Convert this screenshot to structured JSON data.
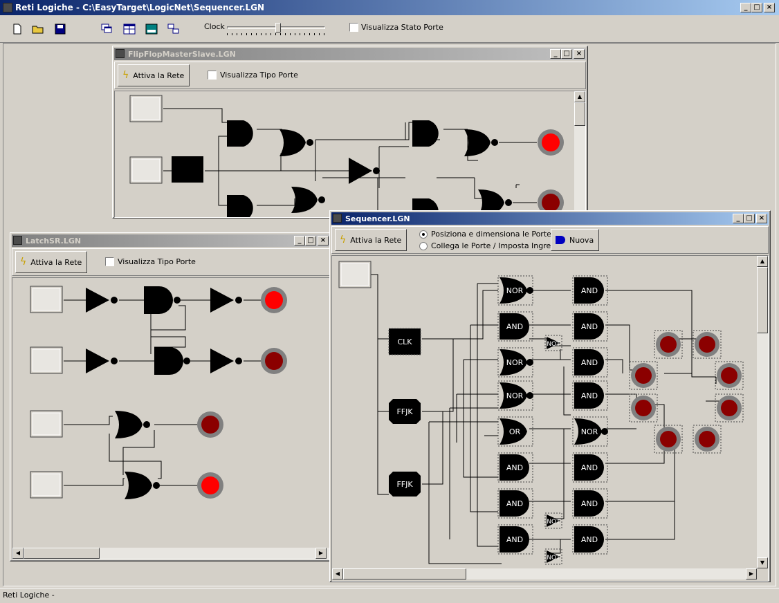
{
  "app": {
    "title": "Reti Logiche - C:\\EasyTarget\\LogicNet\\Sequencer.LGN",
    "status": "Reti Logiche -"
  },
  "toolbar": {
    "icons": [
      "new-icon",
      "open-icon",
      "save-icon",
      "cascade-icon",
      "tile-icon",
      "window-icon",
      "arrange-icon"
    ],
    "clock_label": "Clock",
    "show_state_label": "Visualizza Stato Porte"
  },
  "win_flipflop": {
    "title": "FlipFlopMasterSlave.LGN",
    "activate": "Attiva la Rete",
    "show_type": "Visualizza Tipo Porte"
  },
  "win_latch": {
    "title": "LatchSR.LGN",
    "activate": "Attiva la Rete",
    "show_type": "Visualizza Tipo Porte"
  },
  "win_sequencer": {
    "title": "Sequencer.LGN",
    "activate": "Attiva la Rete",
    "radio_position": "Posiziona e dimensiona le Porte",
    "radio_connect": "Collega le Porte / Imposta Ingressi",
    "new_button": "Nuova",
    "gates": {
      "clk": "CLK",
      "ffjk1": "FFJK",
      "ffjk2": "FFJK",
      "nor": "NOR",
      "and": "AND",
      "or": "OR",
      "not": "NOT"
    }
  },
  "colors": {
    "title_active": "#0a246a",
    "led_on": "#ff0000",
    "led_off": "#8b0000",
    "window_bg": "#d4d0c8"
  }
}
